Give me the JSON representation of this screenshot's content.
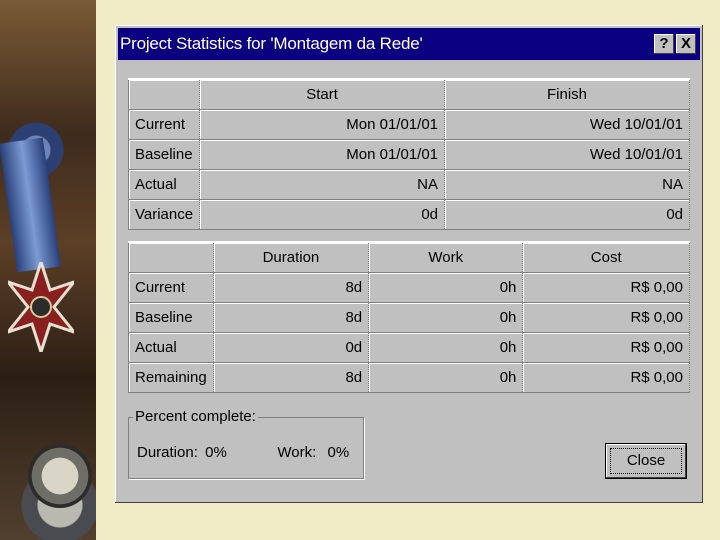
{
  "window": {
    "title": "Project Statistics for 'Montagem da Rede'",
    "help_glyph": "?",
    "close_glyph": "X"
  },
  "dates_table": {
    "headers": [
      "",
      "Start",
      "Finish"
    ],
    "rows": [
      {
        "label": "Current",
        "start": "Mon 01/01/01",
        "finish": "Wed 10/01/01"
      },
      {
        "label": "Baseline",
        "start": "Mon 01/01/01",
        "finish": "Wed 10/01/01"
      },
      {
        "label": "Actual",
        "start": "NA",
        "finish": "NA"
      },
      {
        "label": "Variance",
        "start": "0d",
        "finish": "0d"
      }
    ]
  },
  "totals_table": {
    "headers": [
      "",
      "Duration",
      "Work",
      "Cost"
    ],
    "rows": [
      {
        "label": "Current",
        "duration": "8d",
        "work": "0h",
        "cost": "R$ 0,00"
      },
      {
        "label": "Baseline",
        "duration": "8d",
        "work": "0h",
        "cost": "R$ 0,00"
      },
      {
        "label": "Actual",
        "duration": "0d",
        "work": "0h",
        "cost": "R$ 0,00"
      },
      {
        "label": "Remaining",
        "duration": "8d",
        "work": "0h",
        "cost": "R$ 0,00"
      }
    ]
  },
  "percent_complete": {
    "legend": "Percent complete:",
    "duration_label": "Duration:",
    "duration_value": "0%",
    "work_label": "Work:",
    "work_value": "0%"
  },
  "buttons": {
    "close_label": "Close"
  }
}
